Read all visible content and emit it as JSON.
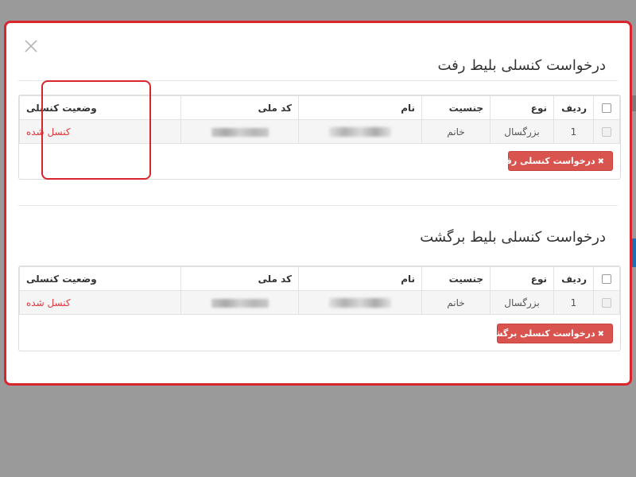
{
  "modal": {
    "close_glyph": "×",
    "accent_color": "#d9262e"
  },
  "outbound": {
    "title": "درخواست کنسلی بلیط رفت",
    "headers": {
      "radif": "ردیف",
      "noe": "نوع",
      "jensiat": "جنسیت",
      "nam": "نام",
      "code_melli": "کد ملی",
      "vaziat": "وضعیت کنسلی"
    },
    "rows": [
      {
        "radif": "1",
        "noe": "بزرگسال",
        "jensiat": "خانم",
        "vaziat": "کنسل شده"
      }
    ],
    "button_label": "درخواست کنسلی رفت",
    "button_icon": "✖"
  },
  "return": {
    "title": "درخواست کنسلی بلیط برگشت",
    "headers": {
      "radif": "ردیف",
      "noe": "نوع",
      "jensiat": "جنسیت",
      "nam": "نام",
      "code_melli": "کد ملی",
      "vaziat": "وضعیت کنسلی"
    },
    "rows": [
      {
        "radif": "1",
        "noe": "بزرگسال",
        "jensiat": "خانم",
        "vaziat": "کنسل شده"
      }
    ],
    "button_label": "درخواست کنسلی برگشت",
    "button_icon": "✖"
  },
  "colors": {
    "status_red": "#e0383e",
    "button_red": "#d9534f"
  }
}
